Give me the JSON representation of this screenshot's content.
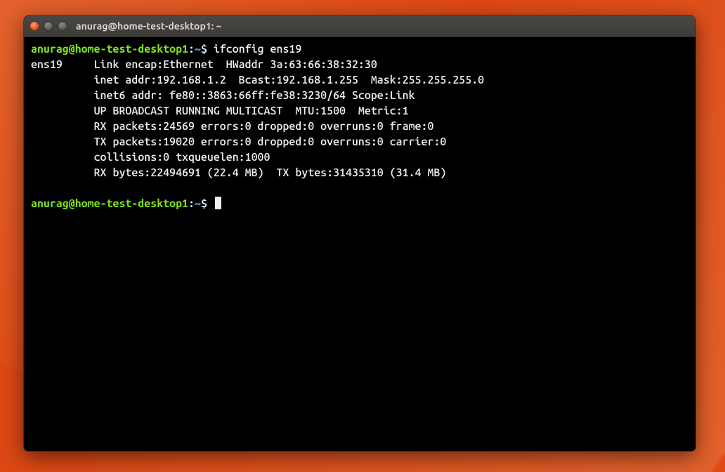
{
  "window": {
    "title": "anurag@home-test-desktop1: ~"
  },
  "titlebar_buttons": {
    "close": "close-window",
    "minimize": "minimize-window",
    "maximize": "maximize-window"
  },
  "prompt": {
    "user_host": "anurag@home-test-desktop1",
    "separator1": ":",
    "path": "~",
    "separator2": "$"
  },
  "session": {
    "command1": "ifconfig ens19",
    "output_lines": [
      "ens19     Link encap:Ethernet  HWaddr 3a:63:66:38:32:30  ",
      "          inet addr:192.168.1.2  Bcast:192.168.1.255  Mask:255.255.255.0",
      "          inet6 addr: fe80::3863:66ff:fe38:3230/64 Scope:Link",
      "          UP BROADCAST RUNNING MULTICAST  MTU:1500  Metric:1",
      "          RX packets:24569 errors:0 dropped:0 overruns:0 frame:0",
      "          TX packets:19020 errors:0 dropped:0 overruns:0 carrier:0",
      "          collisions:0 txqueuelen:1000 ",
      "          RX bytes:22494691 (22.4 MB)  TX bytes:31435310 (31.4 MB)",
      ""
    ]
  }
}
